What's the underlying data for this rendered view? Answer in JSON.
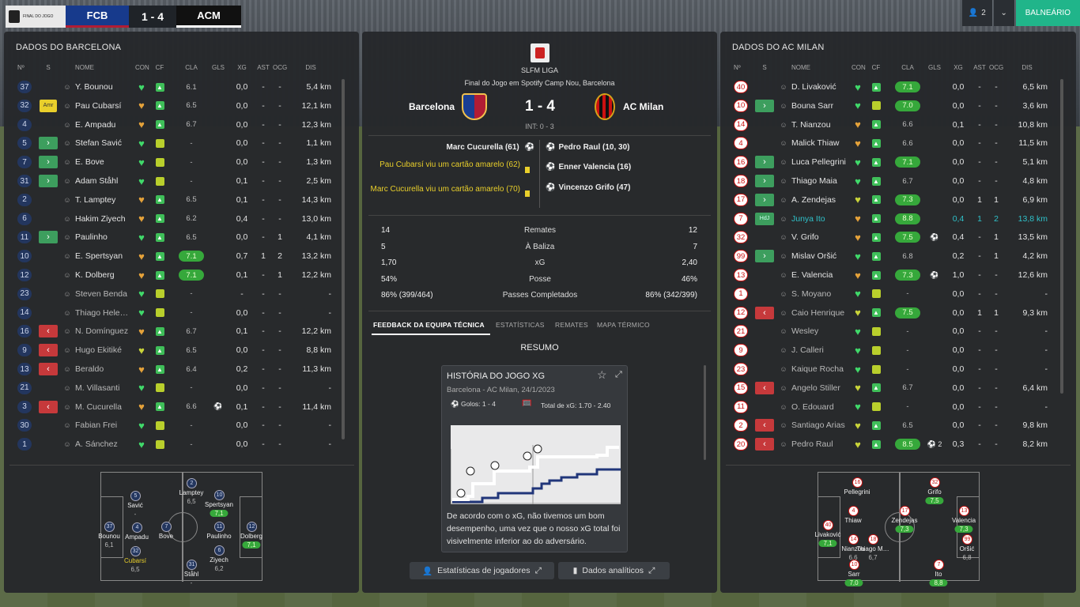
{
  "header": {
    "competition_label": "FINAL DO JOGO",
    "home_abbr": "FCB",
    "score": "1 - 4",
    "away_abbr": "ACM",
    "manager_count": "2",
    "locker_label": "BALNEÁRIO"
  },
  "columns": {
    "no": "Nº",
    "s": "S",
    "name": "NOME",
    "con": "CON",
    "cf": "CF",
    "cla": "CLA",
    "gls": "GLS",
    "xg": "XG",
    "ast": "AST",
    "ocg": "OCG",
    "dis": "DIS"
  },
  "home": {
    "title": "DADOS DO BARCELONA",
    "players": [
      {
        "no": "37",
        "s": "",
        "name": "Y. Bounou",
        "con": "g",
        "cf": "up",
        "cla": "6.1",
        "gls": "",
        "xg": "0,0",
        "ast": "-",
        "ocg": "-",
        "dis": "5,4 km"
      },
      {
        "no": "32",
        "s": "amr",
        "s_label": "Amr",
        "name": "Pau Cubarsí",
        "con": "o",
        "cf": "up",
        "cla": "6.5",
        "gls": "",
        "xg": "0,0",
        "ast": "-",
        "ocg": "-",
        "dis": "12,1 km"
      },
      {
        "no": "4",
        "s": "",
        "name": "E. Ampadu",
        "con": "o",
        "cf": "up",
        "cla": "6.7",
        "gls": "",
        "xg": "0,0",
        "ast": "-",
        "ocg": "-",
        "dis": "12,3 km"
      },
      {
        "no": "5",
        "s": "in",
        "name": "Stefan Savić",
        "con": "g",
        "cf": "mid",
        "cla": "-",
        "gls": "",
        "xg": "0,0",
        "ast": "-",
        "ocg": "-",
        "dis": "1,1 km"
      },
      {
        "no": "7",
        "s": "in",
        "name": "E. Bove",
        "con": "g",
        "cf": "mid",
        "cla": "-",
        "gls": "",
        "xg": "0,0",
        "ast": "-",
        "ocg": "-",
        "dis": "1,3 km"
      },
      {
        "no": "31",
        "s": "in",
        "name": "Adam Ståhl",
        "con": "g",
        "cf": "mid",
        "cla": "-",
        "gls": "",
        "xg": "0,1",
        "ast": "-",
        "ocg": "-",
        "dis": "2,5 km"
      },
      {
        "no": "2",
        "s": "",
        "name": "T. Lamptey",
        "con": "o",
        "cf": "up",
        "cla": "6.5",
        "gls": "",
        "xg": "0,1",
        "ast": "-",
        "ocg": "-",
        "dis": "14,3 km"
      },
      {
        "no": "6",
        "s": "",
        "name": "Hakim Ziyech",
        "con": "o",
        "cf": "up",
        "cla": "6.2",
        "gls": "",
        "xg": "0,4",
        "ast": "-",
        "ocg": "-",
        "dis": "13,0 km"
      },
      {
        "no": "11",
        "s": "in",
        "name": "Paulinho",
        "con": "g",
        "cf": "up",
        "cla": "6.5",
        "gls": "",
        "xg": "0,0",
        "ast": "-",
        "ocg": "1",
        "dis": "4,1 km"
      },
      {
        "no": "10",
        "s": "",
        "name": "E. Spertsyan",
        "con": "o",
        "cf": "up",
        "cla": "7.1",
        "cla_pill": true,
        "gls": "",
        "xg": "0,7",
        "ast": "1",
        "ocg": "2",
        "dis": "13,2 km"
      },
      {
        "no": "12",
        "s": "",
        "name": "K. Dolberg",
        "con": "o",
        "cf": "up",
        "cla": "7.1",
        "cla_pill": true,
        "gls": "",
        "xg": "0,1",
        "ast": "-",
        "ocg": "1",
        "dis": "12,2 km"
      },
      {
        "no": "23",
        "s": "",
        "name": "Steven Benda",
        "con": "g",
        "cf": "mid",
        "cla": "-",
        "gls": "",
        "xg": "-",
        "ast": "-",
        "ocg": "-",
        "dis": "-",
        "dim": true
      },
      {
        "no": "14",
        "s": "",
        "name": "Thiago Hele…",
        "con": "g",
        "cf": "mid",
        "cla": "-",
        "gls": "",
        "xg": "0,0",
        "ast": "-",
        "ocg": "-",
        "dis": "-",
        "dim": true
      },
      {
        "no": "16",
        "s": "out",
        "name": "N. Domínguez",
        "con": "o",
        "cf": "up",
        "cla": "6.7",
        "gls": "",
        "xg": "0,1",
        "ast": "-",
        "ocg": "-",
        "dis": "12,2 km",
        "dim": true
      },
      {
        "no": "9",
        "s": "out",
        "name": "Hugo Ekitiké",
        "con": "y",
        "cf": "up",
        "cla": "6.5",
        "gls": "",
        "xg": "0,0",
        "ast": "-",
        "ocg": "-",
        "dis": "8,8 km",
        "dim": true
      },
      {
        "no": "13",
        "s": "out",
        "name": "Beraldo",
        "con": "o",
        "cf": "up",
        "cla": "6.4",
        "gls": "",
        "xg": "0,2",
        "ast": "-",
        "ocg": "-",
        "dis": "11,3 km",
        "dim": true
      },
      {
        "no": "21",
        "s": "",
        "name": "M. Villasanti",
        "con": "g",
        "cf": "mid",
        "cla": "-",
        "gls": "",
        "xg": "0,0",
        "ast": "-",
        "ocg": "-",
        "dis": "-",
        "dim": true
      },
      {
        "no": "3",
        "s": "out",
        "name": "M. Cucurella",
        "con": "o",
        "cf": "up",
        "cla": "6.6",
        "gls": "⚽",
        "xg": "0,1",
        "ast": "-",
        "ocg": "-",
        "dis": "11,4 km",
        "dim": true
      },
      {
        "no": "30",
        "s": "",
        "name": "Fabian Frei",
        "con": "g",
        "cf": "mid",
        "cla": "-",
        "gls": "",
        "xg": "0,0",
        "ast": "-",
        "ocg": "-",
        "dis": "-",
        "dim": true
      },
      {
        "no": "1",
        "s": "",
        "name": "A. Sánchez",
        "con": "g",
        "cf": "mid",
        "cla": "-",
        "gls": "",
        "xg": "0,0",
        "ast": "-",
        "ocg": "-",
        "dis": "-",
        "dim": true
      }
    ],
    "formation": [
      {
        "no": "37",
        "name": "Bounou",
        "val": "6,1"
      },
      {
        "no": "5",
        "name": "Savić",
        "val": "-"
      },
      {
        "no": "4",
        "name": "Ampadu",
        "val": ""
      },
      {
        "no": "32",
        "name": "Cubarsí",
        "val": "6,5"
      },
      {
        "no": "31",
        "name": "Ståhl",
        "val": "-"
      },
      {
        "no": "2",
        "name": "Lamptey",
        "val": "6,5"
      },
      {
        "no": "7",
        "name": "Bove",
        "val": ""
      },
      {
        "no": "6",
        "name": "Ziyech",
        "val": "6,2"
      },
      {
        "no": "10",
        "name": "Spertsyan",
        "val": "7,1"
      },
      {
        "no": "11",
        "name": "Paulinho",
        "val": ""
      },
      {
        "no": "12",
        "name": "Dolberg",
        "val": "7,1"
      }
    ]
  },
  "away": {
    "title": "DADOS DO AC MILAN",
    "players": [
      {
        "no": "40",
        "s": "",
        "name": "D. Livaković",
        "con": "g",
        "cf": "up",
        "cla": "7.1",
        "cla_pill": true,
        "gls": "",
        "xg": "0,0",
        "ast": "-",
        "ocg": "-",
        "dis": "6,5 km"
      },
      {
        "no": "10",
        "s": "in",
        "name": "Bouna Sarr",
        "con": "g",
        "cf": "mid",
        "cla": "7.0",
        "cla_pill": true,
        "gls": "",
        "xg": "0,0",
        "ast": "-",
        "ocg": "-",
        "dis": "3,6 km"
      },
      {
        "no": "14",
        "s": "",
        "name": "T. Nianzou",
        "con": "o",
        "cf": "up",
        "cla": "6.6",
        "gls": "",
        "xg": "0,1",
        "ast": "-",
        "ocg": "-",
        "dis": "10,8 km"
      },
      {
        "no": "4",
        "s": "",
        "name": "Malick Thiaw",
        "con": "o",
        "cf": "up",
        "cla": "6.6",
        "gls": "",
        "xg": "0,0",
        "ast": "-",
        "ocg": "-",
        "dis": "11,5 km"
      },
      {
        "no": "16",
        "s": "in",
        "name": "Luca Pellegrini",
        "con": "g",
        "cf": "up",
        "cla": "7.1",
        "cla_pill": true,
        "gls": "",
        "xg": "0,0",
        "ast": "-",
        "ocg": "-",
        "dis": "5,1 km"
      },
      {
        "no": "18",
        "s": "in",
        "name": "Thiago Maia",
        "con": "g",
        "cf": "up",
        "cla": "6.7",
        "gls": "",
        "xg": "0,0",
        "ast": "-",
        "ocg": "-",
        "dis": "4,8 km"
      },
      {
        "no": "17",
        "s": "in",
        "name": "A. Zendejas",
        "con": "y",
        "cf": "up",
        "cla": "7.3",
        "cla_pill": true,
        "gls": "",
        "xg": "0,0",
        "ast": "1",
        "ocg": "1",
        "dis": "6,9 km"
      },
      {
        "no": "7",
        "s": "hdj",
        "s_label": "HdJ",
        "name": "Junya Ito",
        "con": "o",
        "cf": "up",
        "cla": "8.8",
        "cla_pill": true,
        "gls": "",
        "xg": "0,4",
        "ast": "1",
        "ocg": "2",
        "dis": "13,8 km",
        "hl": true
      },
      {
        "no": "32",
        "s": "",
        "name": "V. Grifo",
        "con": "o",
        "cf": "up",
        "cla": "7.5",
        "cla_pill": true,
        "gls": "⚽",
        "xg": "0,4",
        "ast": "-",
        "ocg": "1",
        "dis": "13,5 km"
      },
      {
        "no": "99",
        "s": "in",
        "name": "Mislav Oršić",
        "con": "g",
        "cf": "up",
        "cla": "6.8",
        "gls": "",
        "xg": "0,2",
        "ast": "-",
        "ocg": "1",
        "dis": "4,2 km"
      },
      {
        "no": "13",
        "s": "",
        "name": "E. Valencia",
        "con": "o",
        "cf": "up",
        "cla": "7.3",
        "cla_pill": true,
        "gls": "⚽",
        "xg": "1,0",
        "ast": "-",
        "ocg": "-",
        "dis": "12,6 km"
      },
      {
        "no": "1",
        "s": "",
        "name": "S. Moyano",
        "con": "g",
        "cf": "mid",
        "cla": "-",
        "gls": "",
        "xg": "0,0",
        "ast": "-",
        "ocg": "-",
        "dis": "-",
        "dim": true
      },
      {
        "no": "12",
        "s": "out",
        "name": "Caio Henrique",
        "con": "y",
        "cf": "up",
        "cla": "7.5",
        "cla_pill": true,
        "gls": "",
        "xg": "0,0",
        "ast": "1",
        "ocg": "1",
        "dis": "9,3 km",
        "dim": true
      },
      {
        "no": "21",
        "s": "",
        "name": "Wesley",
        "con": "g",
        "cf": "mid",
        "cla": "-",
        "gls": "",
        "xg": "0,0",
        "ast": "-",
        "ocg": "-",
        "dis": "-",
        "dim": true
      },
      {
        "no": "9",
        "s": "",
        "name": "J. Calleri",
        "con": "g",
        "cf": "mid",
        "cla": "-",
        "gls": "",
        "xg": "0,0",
        "ast": "-",
        "ocg": "-",
        "dis": "-",
        "dim": true
      },
      {
        "no": "23",
        "s": "",
        "name": "Kaique Rocha",
        "con": "g",
        "cf": "mid",
        "cla": "-",
        "gls": "",
        "xg": "0,0",
        "ast": "-",
        "ocg": "-",
        "dis": "-",
        "dim": true
      },
      {
        "no": "15",
        "s": "out",
        "name": "Angelo Stiller",
        "con": "y",
        "cf": "up",
        "cla": "6.7",
        "gls": "",
        "xg": "0,0",
        "ast": "-",
        "ocg": "-",
        "dis": "6,4 km",
        "dim": true
      },
      {
        "no": "11",
        "s": "",
        "name": "O. Edouard",
        "con": "g",
        "cf": "mid",
        "cla": "-",
        "gls": "",
        "xg": "0,0",
        "ast": "-",
        "ocg": "-",
        "dis": "-",
        "dim": true
      },
      {
        "no": "2",
        "s": "out",
        "name": "Santiago Arias",
        "con": "y",
        "cf": "up",
        "cla": "6.5",
        "gls": "",
        "xg": "0,0",
        "ast": "-",
        "ocg": "-",
        "dis": "9,8 km",
        "dim": true
      },
      {
        "no": "20",
        "s": "out",
        "name": "Pedro Raul",
        "con": "y",
        "cf": "up",
        "cla": "8.5",
        "cla_pill": true,
        "gls": "⚽ 2",
        "xg": "0,3",
        "ast": "-",
        "ocg": "-",
        "dis": "8,2 km",
        "dim": true
      }
    ],
    "formation": [
      {
        "no": "16",
        "name": "Pellegrini",
        "val": ""
      },
      {
        "no": "32",
        "name": "Grifo",
        "val": "7,5"
      },
      {
        "no": "4",
        "name": "Thiaw",
        "val": ""
      },
      {
        "no": "17",
        "name": "Zendejas",
        "val": "7,3"
      },
      {
        "no": "13",
        "name": "Valencia",
        "val": "7,3"
      },
      {
        "no": "40",
        "name": "Livaković",
        "val": "7,1"
      },
      {
        "no": "14",
        "name": "Nianzou",
        "val": "6,6"
      },
      {
        "no": "18",
        "name": "Thiago M…",
        "val": "6,7"
      },
      {
        "no": "99",
        "name": "Oršić",
        "val": "6,8"
      },
      {
        "no": "10",
        "name": "Sarr",
        "val": "7,0"
      },
      {
        "no": "7",
        "name": "Ito",
        "val": "8,8"
      }
    ]
  },
  "match": {
    "league": "SLFM LIGA",
    "venue": "Final do Jogo em Spotify Camp Nou, Barcelona",
    "home_name": "Barcelona",
    "away_name": "AC Milan",
    "score": "1 - 4",
    "halftime": "INT: 0 - 3",
    "home_events": [
      {
        "text": "Marc Cucurella (61)",
        "type": "goal"
      },
      {
        "text": "Pau Cubarsí viu um cartão amarelo (62)",
        "type": "yellow"
      },
      {
        "text": "Marc Cucurella viu um cartão amarelo (70)",
        "type": "yellow"
      }
    ],
    "away_events": [
      {
        "text": "Pedro Raul (10, 30)",
        "type": "goal"
      },
      {
        "text": "Enner Valencia (16)",
        "type": "goal"
      },
      {
        "text": "Vincenzo Grifo (47)",
        "type": "goal"
      }
    ],
    "stats": [
      {
        "home": "14",
        "label": "Remates",
        "away": "12"
      },
      {
        "home": "5",
        "label": "À Baliza",
        "away": "7"
      },
      {
        "home": "1,70",
        "label": "xG",
        "away": "2,40"
      },
      {
        "home": "54%",
        "label": "Posse",
        "away": "46%"
      },
      {
        "home": "86% (399/464)",
        "label": "Passes Completados",
        "away": "86% (342/399)"
      }
    ],
    "tabs": [
      "FEEDBACK DA EQUIPA TÉCNICA",
      "ESTATÍSTICAS",
      "REMATES",
      "MAPA TÉRMICO"
    ],
    "summary_title": "RESUMO",
    "card": {
      "title": "HISTÓRIA DO JOGO XG",
      "subtitle": "Barcelona - AC Milan, 24/1/2023",
      "goals": "Golos: 1 - 4",
      "total_xg": "Total de xG: 1.70 - 2.40",
      "text": "De acordo com o xG, não tivemos um bom desempenho, uma vez que o nosso xG total foi visivelmente inferior ao do adversário."
    },
    "buttons": {
      "players": "Estatísticas de jogadores",
      "analytics": "Dados analíticos"
    }
  },
  "colors": {
    "accent": "#20b58a",
    "barca_blue": "#173a8c",
    "milan_red": "#c11",
    "positive": "#36a83b"
  }
}
